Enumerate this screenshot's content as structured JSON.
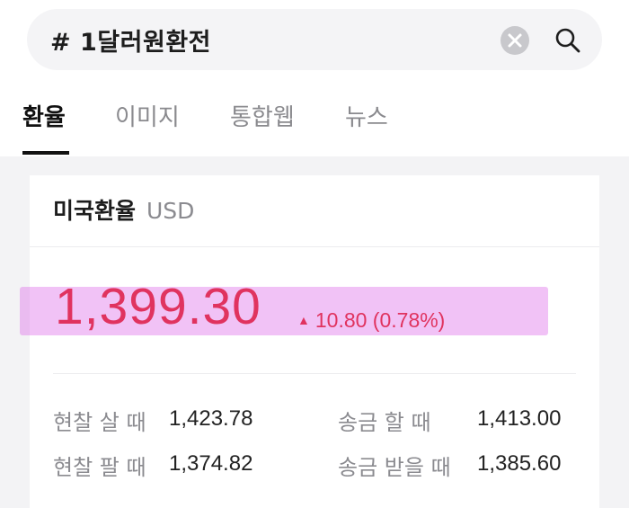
{
  "search": {
    "query": "# 1달러원환전"
  },
  "tabs": [
    {
      "label": "환율"
    },
    {
      "label": "이미지"
    },
    {
      "label": "통합웹"
    },
    {
      "label": "뉴스"
    }
  ],
  "card": {
    "title": "미국환율",
    "currency": "USD",
    "rate": "1,399.30",
    "change": "10.80 (0.78%)",
    "change_direction": "up",
    "accent_color": "#e0335f",
    "rows": [
      {
        "label": "현찰 살 때",
        "value": "1,423.78"
      },
      {
        "label": "송금 할 때",
        "value": "1,413.00"
      },
      {
        "label": "현찰 팔 때",
        "value": "1,374.82"
      },
      {
        "label": "송금 받을 때",
        "value": "1,385.60"
      }
    ]
  }
}
